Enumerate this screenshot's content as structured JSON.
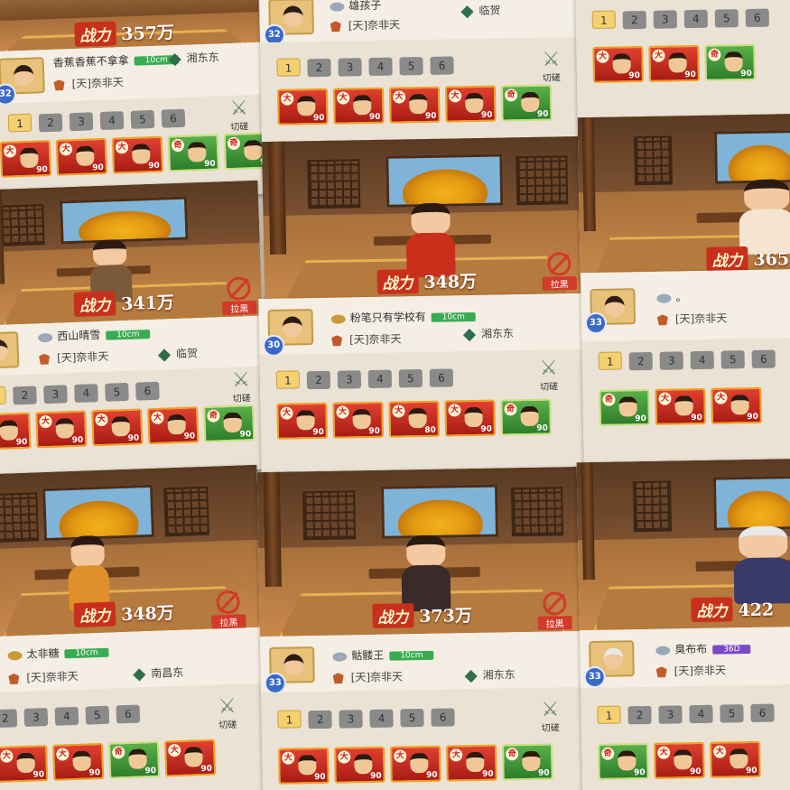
{
  "colors": {
    "accent_red": "#c8301c",
    "tag_green": "#39ac52",
    "tab_active": "#f4d070",
    "unit_red": "#e04030",
    "unit_green": "#5ab04a"
  },
  "labels": {
    "power": "战力",
    "blacklist": "拉黑",
    "spar": "切磋",
    "guild": "[天]奈非天"
  },
  "tabs": [
    "1",
    "2",
    "3",
    "4",
    "5",
    "6"
  ],
  "unit_level": "90",
  "panels": [
    {
      "id": "a",
      "power_value": "357万",
      "player": {
        "name": "香蕉香蕉不拿拿",
        "level": "32",
        "tag": "10cm",
        "guild": "[天]奈非天",
        "location": "湘东东"
      },
      "units": [
        {
          "type": "大",
          "lv": "90"
        },
        {
          "type": "大",
          "lv": "90"
        },
        {
          "type": "大",
          "lv": "90"
        },
        {
          "type": "奇",
          "lv": "90"
        },
        {
          "type": "奇",
          "lv": "90"
        }
      ]
    },
    {
      "id": "b",
      "power_value": "348万",
      "player": {
        "name": "雄孩子",
        "level": "32",
        "tag": "",
        "guild": "[天]奈非天",
        "location": "临贺"
      },
      "units": [
        {
          "type": "大",
          "lv": "90"
        },
        {
          "type": "大",
          "lv": "90"
        },
        {
          "type": "大",
          "lv": "90"
        },
        {
          "type": "大",
          "lv": "90"
        },
        {
          "type": "奇",
          "lv": "90"
        }
      ]
    },
    {
      "id": "c",
      "power_value": "365",
      "player": {
        "name": "",
        "level": "",
        "tag": "",
        "guild": "",
        "location": ""
      },
      "units": [
        {
          "type": "大",
          "lv": "90"
        },
        {
          "type": "大",
          "lv": "90"
        },
        {
          "type": "奇",
          "lv": "90"
        }
      ]
    },
    {
      "id": "d",
      "power_value": "341万",
      "player": {
        "name": "西山晴雪",
        "level": "",
        "tag": "10cm",
        "guild": "[天]奈非天",
        "location": "临贺"
      },
      "units": [
        {
          "type": "大",
          "lv": "90"
        },
        {
          "type": "大",
          "lv": "90"
        },
        {
          "type": "大",
          "lv": "90"
        },
        {
          "type": "大",
          "lv": "90"
        },
        {
          "type": "奇",
          "lv": "90"
        }
      ]
    },
    {
      "id": "e",
      "power_value": "373万",
      "player": {
        "name": "粉笔只有学校有",
        "level": "30",
        "tag": "10cm",
        "guild": "[天]奈非天",
        "location": "湘东东"
      },
      "units": [
        {
          "type": "大",
          "lv": "90"
        },
        {
          "type": "大",
          "lv": "90"
        },
        {
          "type": "大",
          "lv": "80"
        },
        {
          "type": "大",
          "lv": "90"
        },
        {
          "type": "奇",
          "lv": "90"
        }
      ]
    },
    {
      "id": "f",
      "power_value": "422",
      "player": {
        "name": "。",
        "level": "33",
        "tag": "",
        "guild": "[天]奈非天",
        "location": ""
      },
      "units": [
        {
          "type": "奇",
          "lv": "90"
        },
        {
          "type": "大",
          "lv": "90"
        },
        {
          "type": "大",
          "lv": "90"
        }
      ]
    },
    {
      "id": "g",
      "power_value": "348万",
      "player": {
        "name": "太非糖",
        "level": "",
        "tag": "10cm",
        "guild": "[天]奈非天",
        "location": "南昌东"
      },
      "units": [
        {
          "type": "大",
          "lv": "90"
        },
        {
          "type": "大",
          "lv": "90"
        },
        {
          "type": "奇",
          "lv": "90"
        },
        {
          "type": "大",
          "lv": "90"
        }
      ]
    },
    {
      "id": "h",
      "power_value": "",
      "player": {
        "name": "骷髅王",
        "level": "33",
        "tag": "10cm",
        "guild": "[天]奈非天",
        "location": "湘东东"
      },
      "units": [
        {
          "type": "大",
          "lv": "90"
        },
        {
          "type": "大",
          "lv": "90"
        },
        {
          "type": "大",
          "lv": "90"
        },
        {
          "type": "大",
          "lv": "90"
        },
        {
          "type": "奇",
          "lv": "90"
        }
      ]
    },
    {
      "id": "i",
      "power_value": "",
      "player": {
        "name": "臭布布",
        "level": "33",
        "tag": "36D",
        "guild": "[天]奈非天",
        "location": ""
      },
      "units": [
        {
          "type": "奇",
          "lv": "90"
        },
        {
          "type": "大",
          "lv": "90"
        },
        {
          "type": "大",
          "lv": "90"
        }
      ]
    }
  ]
}
